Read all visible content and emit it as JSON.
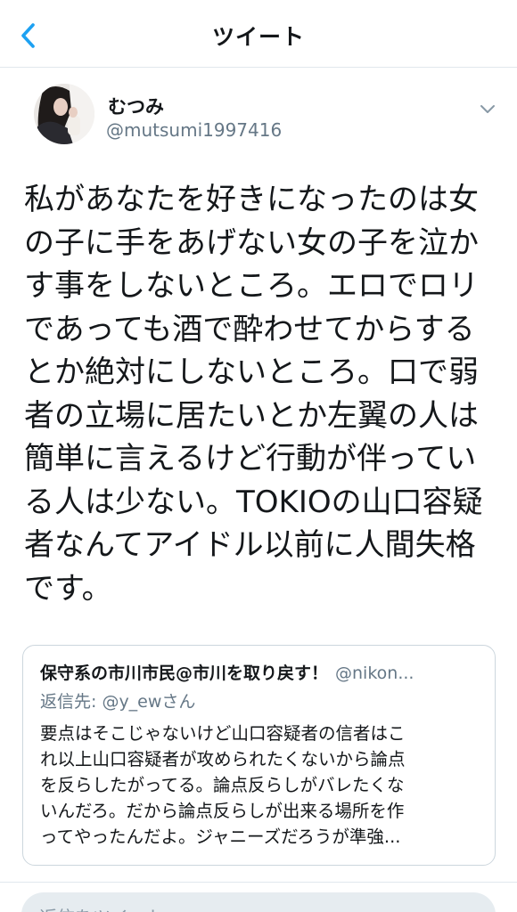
{
  "header": {
    "title": "ツイート",
    "back_icon": "chevron-left-icon"
  },
  "colors": {
    "accent": "#1da1f2",
    "text_primary": "#14171a",
    "text_secondary": "#657786",
    "border": "#e1e8ed"
  },
  "tweet": {
    "author": {
      "display_name": "むつみ",
      "handle": "@mutsumi1997416"
    },
    "menu_icon": "chevron-down-icon",
    "text": "私があなたを好きになったのは女\nの子に手をあげない女の子を泣か\nす事をしないところ。エロでロリ\nであっても酒で酔わせてからする\nとか絶対にしないところ。口で弱\n者の立場に居たいとか左翼の人は\n簡単に言えるけど行動が伴ってい\nる人は少ない。TOKIOの山口容疑\n者なんてアイドル以前に人間失格\nです。"
  },
  "quoted_tweet": {
    "display_name": "保守系の市川市民@市川を取り戻す！",
    "handle": "@nikon...",
    "reply_to": "返信先: @y_ewさん",
    "text": "要点はそこじゃないけど山口容疑者の信者はこ\nれ以上山口容疑者が攻められたくないから論点\nを反らしたがってる。論点反らしがバレたくな\nいんだろ。だから論点反らしが出来る場所を作\nってやったんだよ。ジャニーズだろうが準強..."
  },
  "reply_bar": {
    "placeholder": "返信をツイート"
  }
}
